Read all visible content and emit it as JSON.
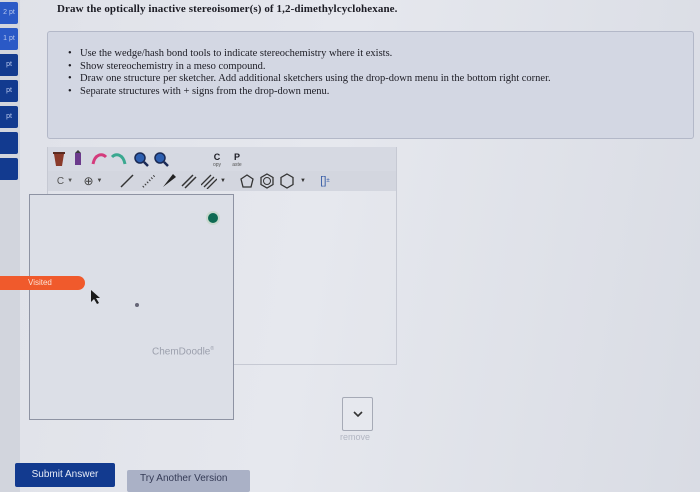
{
  "sidebar": {
    "tabs": [
      {
        "label": "2 pt",
        "style": "light"
      },
      {
        "label": "1 pt",
        "style": "light"
      },
      {
        "label": "pt",
        "style": "dark"
      },
      {
        "label": "pt",
        "style": "dark"
      },
      {
        "label": "pt",
        "style": "dark"
      },
      {
        "label": "",
        "style": "dark"
      },
      {
        "label": "",
        "style": "dark"
      }
    ]
  },
  "question": {
    "title": "Draw the optically inactive stereoisomer(s) of 1,2-dimethylcyclohexane.",
    "instructions": [
      "Use the wedge/hash bond tools to indicate stereochemistry where it exists.",
      "Show stereochemistry in a meso compound.",
      "Draw one structure per sketcher. Add additional sketchers using the drop-down menu in the bottom right corner.",
      "Separate structures with + signs from the drop-down menu."
    ]
  },
  "sketcher": {
    "toolbar": {
      "copy_label": "C",
      "copy_sub": "opy",
      "paste_label": "P",
      "paste_sub": "aste",
      "element_label": "C"
    },
    "watermark": "ChemDoodle",
    "watermark_mark": "®"
  },
  "visited_label": "Visited",
  "dropdown": {
    "remove_label": "remove"
  },
  "buttons": {
    "submit": "Submit Answer",
    "try_another": "Try Another Version"
  },
  "colors": {
    "brand_blue": "#123a8f",
    "visited_orange": "#f05a2c",
    "status_green": "#0e6b53"
  }
}
